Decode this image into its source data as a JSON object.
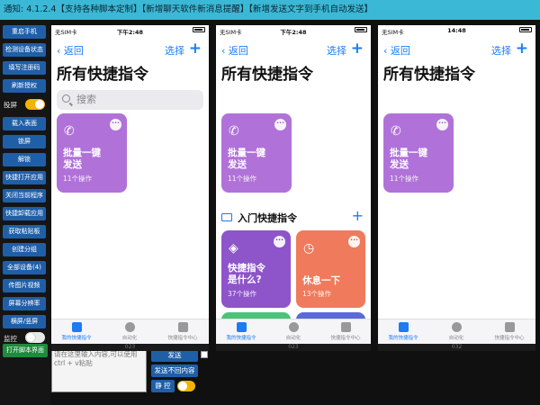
{
  "notice": "通知:  4.1.2.4【支持各种脚本定制】【新增聊天软件新消息提醒】【新增发送文字到手机自动发送】",
  "sidebar": {
    "buttons": [
      "重启手机",
      "检测设备状态",
      "填写注册码",
      "刷新授权",
      "载入表面",
      "锁屏",
      "解锁",
      "快捷打开应用",
      "关闭当前程序",
      "快捷卸载应用",
      "获取粘贴板",
      "创建分组",
      "全部设备(4)",
      "传图片视频",
      "屏幕分辨率",
      "横屏/竖屏"
    ],
    "toggle1_label": "投屏",
    "toggle2_label": "监控",
    "open_script": "打开脚本界面"
  },
  "bottom": {
    "input_placeholder": "请在这里输入内容,可以使用ctrl + v粘贴",
    "send": "发送",
    "send_no_enter": "发送不回内容",
    "mute_label": "静 控"
  },
  "phones": [
    {
      "status_left": "无SIM卡",
      "time": "下午2:48",
      "back": "返回",
      "select": "选择",
      "title": "所有快捷指令",
      "search": "搜索",
      "card_title": "批量一键\n发送",
      "card_sub": "11个操作",
      "tabs": [
        "我的快捷指令",
        "自动化",
        "快捷指令中心"
      ],
      "footer": "023"
    },
    {
      "status_left": "无SIM卡",
      "time": "下午2:48",
      "back": "返回",
      "select": "选择",
      "title": "所有快捷指令",
      "card_title": "批量一键\n发送",
      "card_sub": "11个操作",
      "folder": "入门快捷指令",
      "card2_title": "快捷指令\n是什么?",
      "card2_sub": "37个操作",
      "card3_title": "休息一下",
      "card3_sub": "13个操作",
      "tabs": [
        "我的快捷指令",
        "自动化",
        "快捷指令中心"
      ],
      "footer": "023"
    },
    {
      "status_left": "无SIM卡",
      "time": "14:48",
      "back": "返回",
      "select": "选择",
      "title": "所有快捷指令",
      "card_title": "批量一键\n发送",
      "card_sub": "11个操作",
      "tabs": [
        "我的快捷指令",
        "自动化",
        "快捷指令中心"
      ],
      "footer": "032"
    }
  ]
}
